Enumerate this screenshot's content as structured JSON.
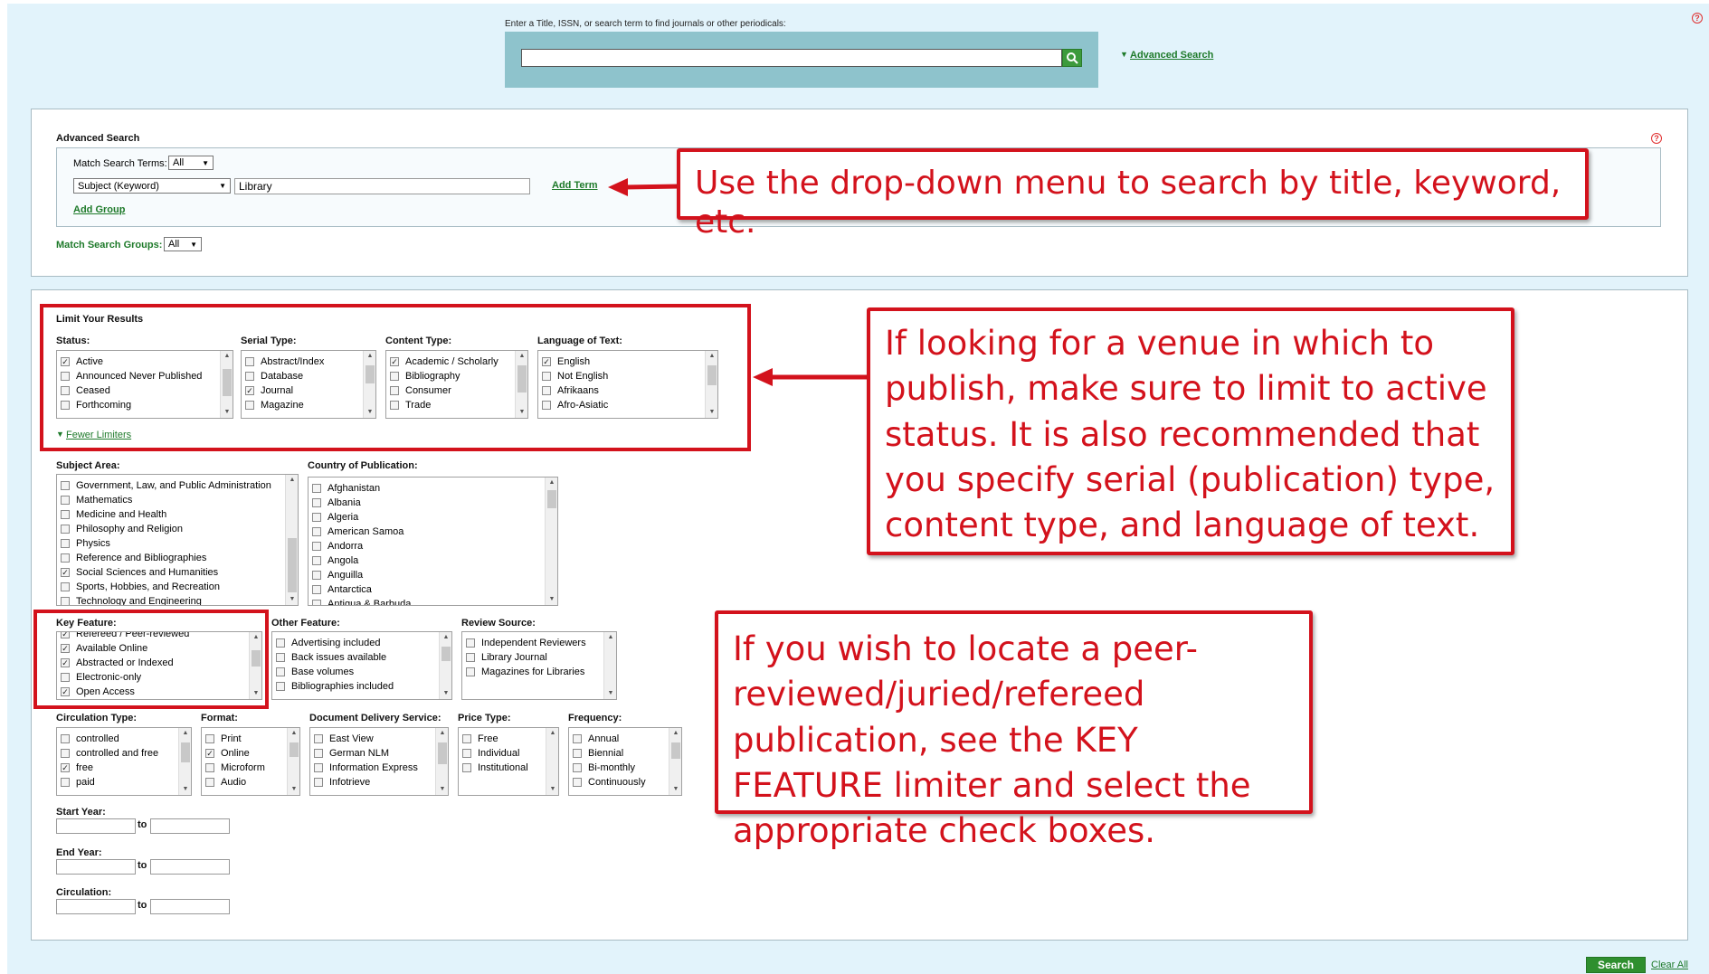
{
  "top_search": {
    "hint": "Enter a Title, ISSN, or search term to find journals or other periodicals:",
    "value": "",
    "advanced_link": "Advanced Search"
  },
  "advanced": {
    "title": "Advanced Search",
    "match_terms_label": "Match Search Terms:",
    "match_terms_value": "All",
    "field_value": "Subject (Keyword)",
    "term_value": "Library",
    "add_term": "Add Term",
    "add_group": "Add Group",
    "match_groups_label": "Match Search Groups:",
    "match_groups_value": "All"
  },
  "limits": {
    "title": "Limit Your Results",
    "fewer_limiters": "Fewer Limiters",
    "status": {
      "label": "Status:",
      "items": [
        {
          "text": "Active",
          "checked": true
        },
        {
          "text": "Announced Never Published",
          "checked": false
        },
        {
          "text": "Ceased",
          "checked": false
        },
        {
          "text": "Forthcoming",
          "checked": false
        }
      ]
    },
    "serial_type": {
      "label": "Serial Type:",
      "items": [
        {
          "text": "Abstract/Index",
          "checked": false
        },
        {
          "text": "Database",
          "checked": false
        },
        {
          "text": "Journal",
          "checked": true
        },
        {
          "text": "Magazine",
          "checked": false
        }
      ]
    },
    "content_type": {
      "label": "Content Type:",
      "items": [
        {
          "text": "Academic / Scholarly",
          "checked": true
        },
        {
          "text": "Bibliography",
          "checked": false
        },
        {
          "text": "Consumer",
          "checked": false
        },
        {
          "text": "Trade",
          "checked": false
        }
      ]
    },
    "language": {
      "label": "Language of Text:",
      "items": [
        {
          "text": "English",
          "checked": true
        },
        {
          "text": "Not English",
          "checked": false
        },
        {
          "text": "Afrikaans",
          "checked": false
        },
        {
          "text": "Afro-Asiatic",
          "checked": false
        }
      ]
    },
    "subject_area": {
      "label": "Subject Area:",
      "items": [
        {
          "text": "Government, Law, and Public Administration",
          "checked": false
        },
        {
          "text": "Mathematics",
          "checked": false
        },
        {
          "text": "Medicine and Health",
          "checked": false
        },
        {
          "text": "Philosophy and Religion",
          "checked": false
        },
        {
          "text": "Physics",
          "checked": false
        },
        {
          "text": "Reference and Bibliographies",
          "checked": false
        },
        {
          "text": "Social Sciences and Humanities",
          "checked": true
        },
        {
          "text": "Sports, Hobbies, and Recreation",
          "checked": false
        },
        {
          "text": "Technology and Engineering",
          "checked": false
        }
      ]
    },
    "country": {
      "label": "Country of Publication:",
      "items": [
        {
          "text": "Afghanistan",
          "checked": false
        },
        {
          "text": "Albania",
          "checked": false
        },
        {
          "text": "Algeria",
          "checked": false
        },
        {
          "text": "American Samoa",
          "checked": false
        },
        {
          "text": "Andorra",
          "checked": false
        },
        {
          "text": "Angola",
          "checked": false
        },
        {
          "text": "Anguilla",
          "checked": false
        },
        {
          "text": "Antarctica",
          "checked": false
        },
        {
          "text": "Antigua & Barbuda",
          "checked": false
        }
      ]
    },
    "key_feature": {
      "label": "Key Feature:",
      "items": [
        {
          "text": "Refereed / Peer-reviewed",
          "checked": true
        },
        {
          "text": "Available Online",
          "checked": true
        },
        {
          "text": "Abstracted or Indexed",
          "checked": true
        },
        {
          "text": "Electronic-only",
          "checked": false
        },
        {
          "text": "Open Access",
          "checked": true
        }
      ]
    },
    "other_feature": {
      "label": "Other Feature:",
      "items": [
        {
          "text": "Advertising included",
          "checked": false
        },
        {
          "text": "Back issues available",
          "checked": false
        },
        {
          "text": "Base volumes",
          "checked": false
        },
        {
          "text": "Bibliographies included",
          "checked": false
        }
      ]
    },
    "review_source": {
      "label": "Review Source:",
      "items": [
        {
          "text": "Independent Reviewers",
          "checked": false
        },
        {
          "text": "Library Journal",
          "checked": false
        },
        {
          "text": "Magazines for Libraries",
          "checked": false
        }
      ]
    },
    "circulation_type": {
      "label": "Circulation Type:",
      "items": [
        {
          "text": "controlled",
          "checked": false
        },
        {
          "text": "controlled and free",
          "checked": false
        },
        {
          "text": "free",
          "checked": true
        },
        {
          "text": "paid",
          "checked": false
        }
      ]
    },
    "format": {
      "label": "Format:",
      "items": [
        {
          "text": "Print",
          "checked": false
        },
        {
          "text": "Online",
          "checked": true
        },
        {
          "text": "Microform",
          "checked": false
        },
        {
          "text": "Audio",
          "checked": false
        }
      ]
    },
    "delivery": {
      "label": "Document Delivery Service:",
      "items": [
        {
          "text": "East View",
          "checked": false
        },
        {
          "text": "German NLM",
          "checked": false
        },
        {
          "text": "Information Express",
          "checked": false
        },
        {
          "text": "Infotrieve",
          "checked": false
        }
      ]
    },
    "price_type": {
      "label": "Price Type:",
      "items": [
        {
          "text": "Free",
          "checked": false
        },
        {
          "text": "Individual",
          "checked": false
        },
        {
          "text": "Institutional",
          "checked": false
        }
      ]
    },
    "frequency": {
      "label": "Frequency:",
      "items": [
        {
          "text": "Annual",
          "checked": false
        },
        {
          "text": "Biennial",
          "checked": false
        },
        {
          "text": "Bi-monthly",
          "checked": false
        },
        {
          "text": "Continuously",
          "checked": false
        }
      ]
    },
    "start_year": "Start Year:",
    "end_year": "End Year:",
    "circulation": "Circulation:",
    "to": "to"
  },
  "callouts": {
    "dropdown": "Use the drop-down menu to search by title, keyword, etc.",
    "status": "If looking for a venue in which to publish, make sure to limit to active status. It is also recommended that you specify serial (publication) type, content type, and language of text.",
    "key_feature": "If you wish to locate a peer-reviewed/juried/refereed publication, see the KEY FEATURE limiter and select the appropriate check boxes."
  },
  "footer": {
    "search": "Search",
    "clear_all": "Clear All"
  },
  "colors": {
    "accent_green": "#1e7a2a",
    "callout_red": "#d3121c",
    "band": "#8ec3cc",
    "canvas": "#e2f3fb"
  }
}
